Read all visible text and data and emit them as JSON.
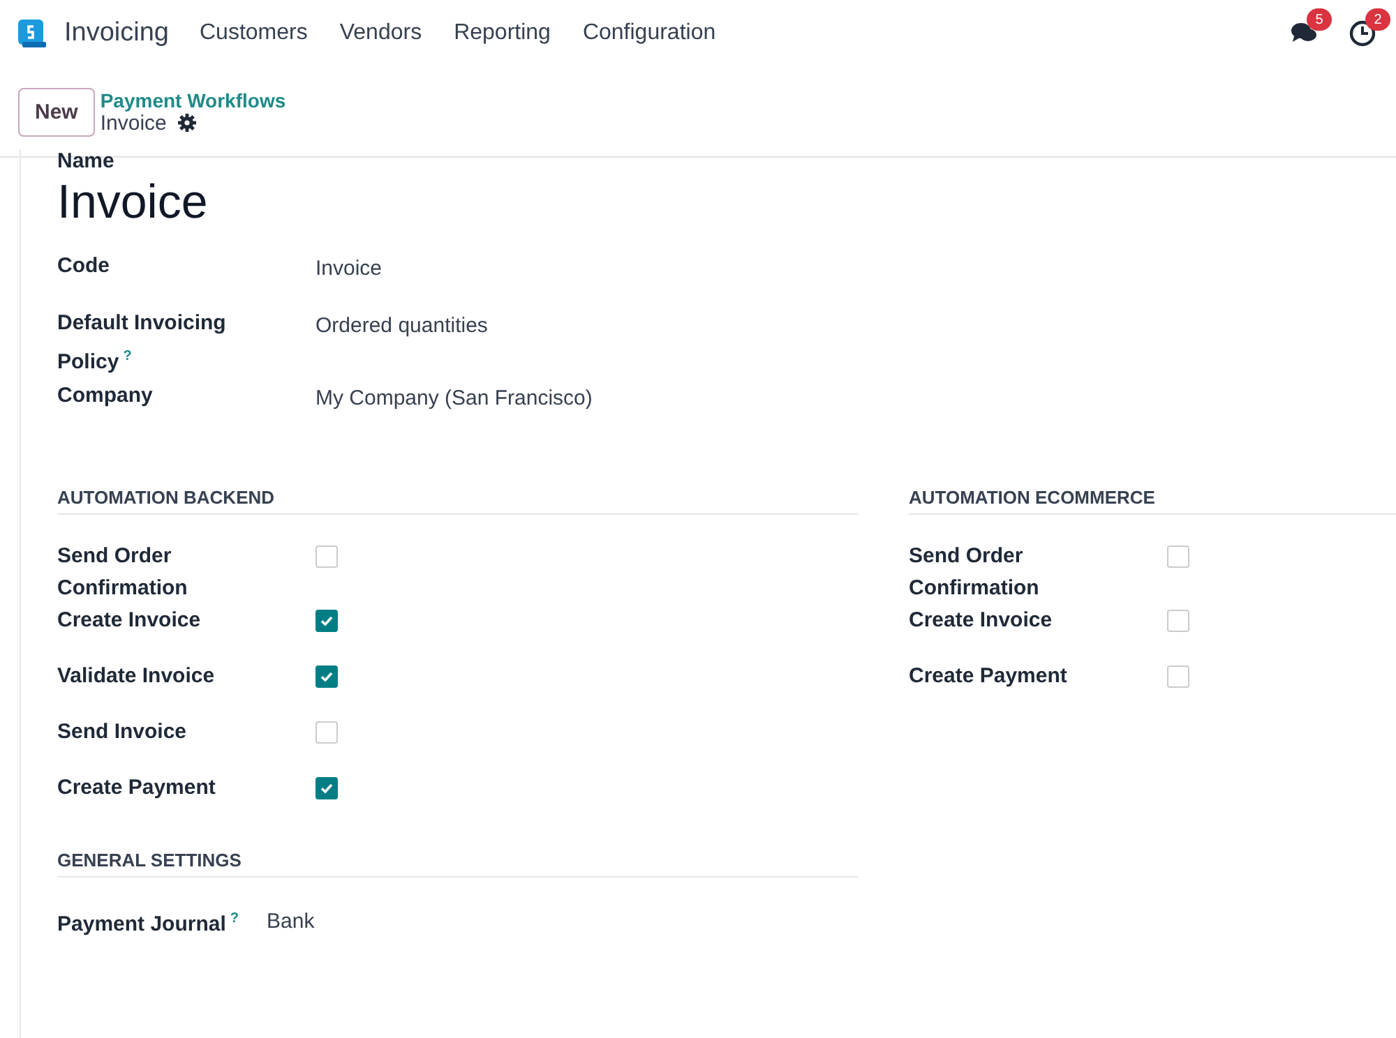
{
  "navbar": {
    "app": "Invoicing",
    "menu": [
      "Customers",
      "Vendors",
      "Reporting",
      "Configuration"
    ],
    "badges": [
      {
        "kind": "chat",
        "count": "5"
      },
      {
        "kind": "clock",
        "count": "2"
      }
    ]
  },
  "control_panel": {
    "new_button": "New",
    "breadcrumb": "Payment Workflows",
    "record": "Invoice"
  },
  "form": {
    "name_label": "Name",
    "name": "Invoice",
    "fields": [
      {
        "label": "Code",
        "help": false,
        "value": "Invoice"
      },
      {
        "label": "Default Invoicing Policy",
        "help": true,
        "value": "Ordered quantities"
      },
      {
        "label": "Company",
        "help": false,
        "value": "My Company (San Francisco)"
      }
    ],
    "help_mark": "?",
    "groups": [
      {
        "title": "AUTOMATION BACKEND",
        "items": [
          {
            "label": "Send Order Confirmation",
            "checked": false
          },
          {
            "label": "Create Invoice",
            "checked": true
          },
          {
            "label": "Validate Invoice",
            "checked": true
          },
          {
            "label": "Send Invoice",
            "checked": false
          },
          {
            "label": "Create Payment",
            "checked": true
          }
        ]
      },
      {
        "title": "AUTOMATION ECOMMERCE",
        "items": [
          {
            "label": "Send Order Confirmation",
            "checked": false
          },
          {
            "label": "Create Invoice",
            "checked": false
          },
          {
            "label": "Create Payment",
            "checked": false
          }
        ]
      }
    ],
    "general": {
      "title": "GENERAL SETTINGS",
      "fields": [
        {
          "label": "Payment Journal",
          "help": true,
          "value": "Bank"
        }
      ]
    }
  }
}
